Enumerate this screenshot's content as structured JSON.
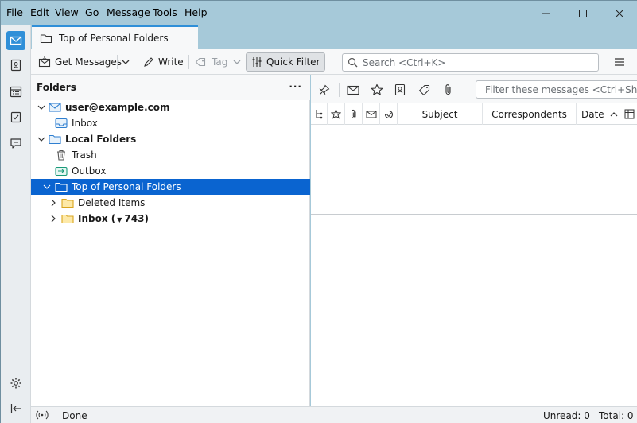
{
  "menubar": {
    "items": [
      {
        "key": "F",
        "rest": "ile"
      },
      {
        "key": "E",
        "rest": "dit"
      },
      {
        "key": "V",
        "rest": "iew"
      },
      {
        "key": "G",
        "rest": "o"
      },
      {
        "key": "M",
        "rest": "essage"
      },
      {
        "key": "T",
        "rest": "ools"
      },
      {
        "key": "H",
        "rest": "elp"
      }
    ]
  },
  "tab": {
    "label": "Top of Personal Folders"
  },
  "toolbar": {
    "get_messages": "Get Messages",
    "write": "Write",
    "tag": "Tag",
    "quick_filter": "Quick Filter",
    "search_placeholder": "Search <Ctrl+K>"
  },
  "folders": {
    "header": "Folders",
    "more": "···",
    "rows": [
      {
        "name": "user@example.com"
      },
      {
        "name": "Inbox"
      },
      {
        "name": "Local Folders"
      },
      {
        "name": "Trash"
      },
      {
        "name": "Outbox"
      },
      {
        "name": "Top of Personal Folders"
      },
      {
        "name": "Deleted Items"
      },
      {
        "name": "Inbox (",
        "count": "743)"
      }
    ]
  },
  "thread": {
    "filter_placeholder": "Filter these messages <Ctrl+Shift+K>",
    "columns": {
      "subject": "Subject",
      "correspondents": "Correspondents",
      "date": "Date"
    }
  },
  "status": {
    "text": "Done",
    "unread": "Unread: 0",
    "total": "Total: 0"
  },
  "colors": {
    "accent": "#2f8fd8",
    "selection": "#0a64d0",
    "titlebar": "#a6c9d9",
    "folder_yellow": "#f5c542"
  }
}
